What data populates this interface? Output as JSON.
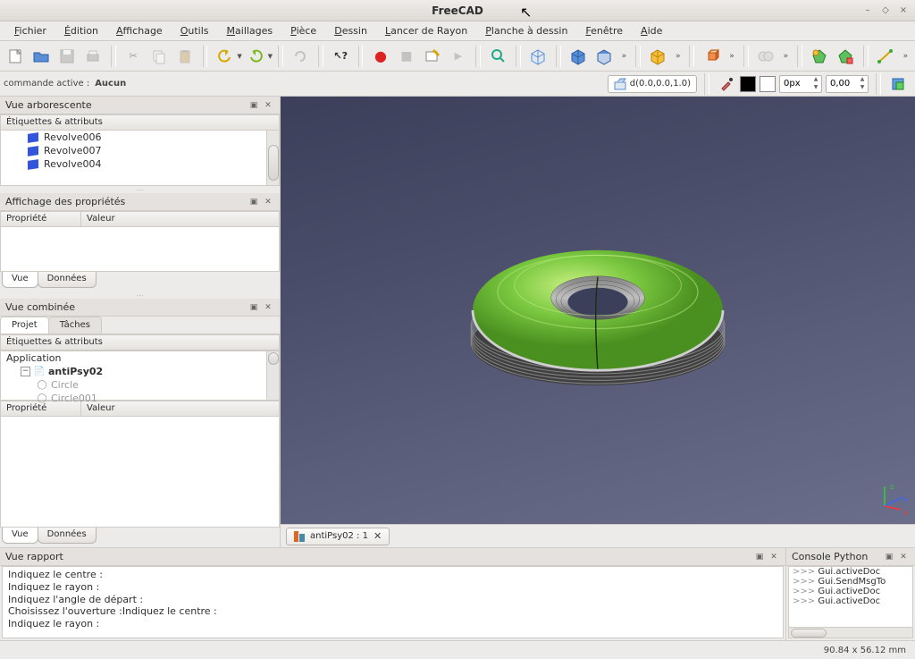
{
  "app_title": "FreeCAD",
  "menus": {
    "file": "Fichier",
    "edit": "Édition",
    "view": "Affichage",
    "tools": "Outils",
    "meshes": "Maillages",
    "part": "Pièce",
    "draft": "Dessin",
    "ray": "Lancer de Rayon",
    "drawing": "Planche à dessin",
    "window": "Fenêtre",
    "help": "Aide"
  },
  "active_command": {
    "label": "commande active :",
    "value": "Aucun"
  },
  "draft": {
    "vector_btn": "d(0.0,0.0,1.0)",
    "px_value": "0px",
    "num_value": "0,00"
  },
  "tree_panel": {
    "title": "Vue arborescente",
    "header": "Étiquettes & attributs",
    "items": [
      "Revolve006",
      "Revolve007",
      "Revolve004"
    ]
  },
  "props_panel": {
    "title": "Affichage des propriétés",
    "col_prop": "Propriété",
    "col_val": "Valeur"
  },
  "tabs": {
    "view": "Vue",
    "data": "Données",
    "project": "Projet",
    "tasks": "Tâches"
  },
  "combo_panel": {
    "title": "Vue combinée",
    "header": "Étiquettes & attributs",
    "root": "Application",
    "doc": "antiPsy02",
    "children": [
      "Circle",
      "Circle001"
    ]
  },
  "doc_tab": "antiPsy02 : 1",
  "report": {
    "title": "Vue rapport",
    "lines": [
      "Indiquez le centre :",
      "Indiquez le rayon :",
      "Indiquez l'angle de départ :",
      "Choisissez l'ouverture :Indiquez le centre :",
      "Indiquez le rayon :"
    ]
  },
  "console": {
    "title": "Console Python",
    "lines": [
      "Gui.activeDoc",
      "Gui.SendMsgTo",
      "Gui.activeDoc",
      "Gui.activeDoc"
    ]
  },
  "status": "90.84 x 56.12 mm"
}
